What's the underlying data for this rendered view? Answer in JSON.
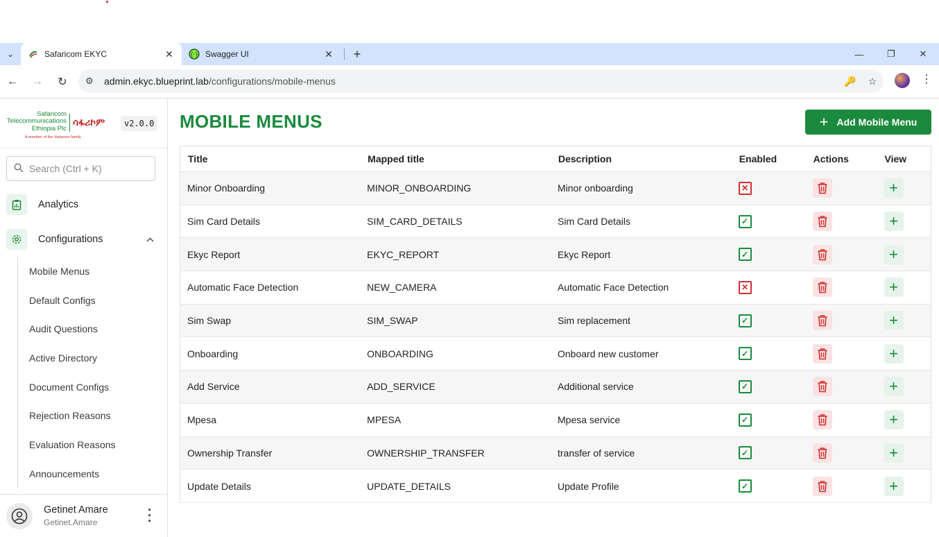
{
  "browser": {
    "tabs": [
      {
        "title": "Safaricom EKYC",
        "active": true
      },
      {
        "title": "Swagger UI",
        "active": false
      }
    ],
    "new_tab": "+",
    "url_host": "admin.ekyc.blueprint.lab",
    "url_path": "/configurations/mobile-menus"
  },
  "sidebar": {
    "logo": {
      "line1": "Safaricom",
      "line2": "Telecommunications",
      "line3": "Ethiopia Plc",
      "amharic": "ሳፋሪኮም",
      "tagline": "A member of the Vodacom family"
    },
    "version": "v2.0.0",
    "search_placeholder": "Search (Ctrl + K)",
    "nav": {
      "analytics": "Analytics",
      "configurations": "Configurations"
    },
    "sub_items": [
      "Mobile Menus",
      "Default Configs",
      "Audit Questions",
      "Active Directory",
      "Document Configs",
      "Rejection Reasons",
      "Evaluation Reasons",
      "Announcements"
    ],
    "user": {
      "name": "Getinet Amare",
      "email": "Getinet.Amare"
    }
  },
  "main": {
    "title": "MOBILE MENUS",
    "add_button": "Add Mobile Menu",
    "columns": [
      "Title",
      "Mapped title",
      "Description",
      "Enabled",
      "Actions",
      "View"
    ],
    "rows": [
      {
        "title": "Minor Onboarding",
        "mapped": "MINOR_ONBOARDING",
        "description": "Minor onboarding",
        "enabled": false
      },
      {
        "title": "Sim Card Details",
        "mapped": "SIM_CARD_DETAILS",
        "description": "Sim Card Details",
        "enabled": true
      },
      {
        "title": "Ekyc Report",
        "mapped": "EKYC_REPORT",
        "description": "Ekyc Report",
        "enabled": true
      },
      {
        "title": "Automatic Face Detection",
        "mapped": "NEW_CAMERA",
        "description": "Automatic Face Detection",
        "enabled": false
      },
      {
        "title": "Sim Swap",
        "mapped": "SIM_SWAP",
        "description": "Sim replacement",
        "enabled": true
      },
      {
        "title": "Onboarding",
        "mapped": "ONBOARDING",
        "description": "Onboard new customer",
        "enabled": true
      },
      {
        "title": "Add Service",
        "mapped": "ADD_SERVICE",
        "description": "Additional service",
        "enabled": true
      },
      {
        "title": "Mpesa",
        "mapped": "MPESA",
        "description": "Mpesa service",
        "enabled": true
      },
      {
        "title": "Ownership Transfer",
        "mapped": "OWNERSHIP_TRANSFER",
        "description": "transfer of service",
        "enabled": true
      },
      {
        "title": "Update Details",
        "mapped": "UPDATE_DETAILS",
        "description": "Update Profile",
        "enabled": true
      }
    ]
  },
  "colors": {
    "brand_green": "#1b8a3d",
    "danger_red": "#d32f2f",
    "tabstrip": "#d3e3fd"
  }
}
